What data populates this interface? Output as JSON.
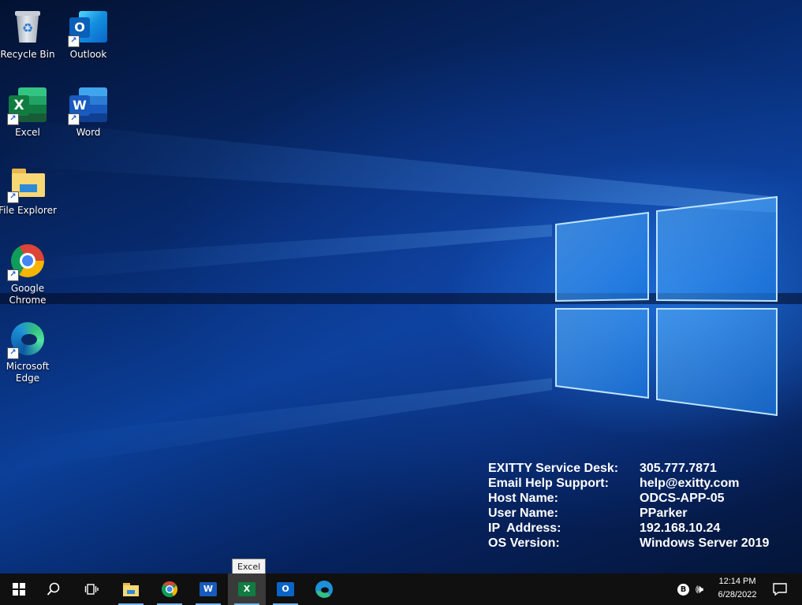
{
  "desktop": {
    "icons": [
      {
        "label": "Recycle Bin",
        "icon": "recycle-bin-icon"
      },
      {
        "label": "Outlook",
        "icon": "outlook-icon",
        "letter": "O"
      },
      {
        "label": "Excel",
        "icon": "excel-icon",
        "letter": "X"
      },
      {
        "label": "Word",
        "icon": "word-icon",
        "letter": "W"
      },
      {
        "label": "File Explorer",
        "icon": "file-explorer-icon"
      },
      {
        "label": "Google Chrome",
        "icon": "chrome-icon"
      },
      {
        "label": "Microsoft Edge",
        "icon": "edge-icon"
      }
    ],
    "shortcut_glyph": "↗"
  },
  "info": {
    "rows": [
      {
        "label": "EXITTY Service Desk:",
        "value": "305.777.7871"
      },
      {
        "label": "Email Help Support:",
        "value": "help@exitty.com"
      },
      {
        "label": "Host Name:",
        "value": "ODCS-APP-05"
      },
      {
        "label": "User Name:",
        "value": "PParker"
      },
      {
        "label": "IP  Address:",
        "value": "192.168.10.24"
      },
      {
        "label": "OS Version:",
        "value": "Windows Server 2019"
      }
    ]
  },
  "tooltip": {
    "text": "Excel"
  },
  "taskbar": {
    "items": [
      "start-icon",
      "search-icon",
      "task-view-icon",
      "file-explorer-icon",
      "chrome-icon",
      "word-icon",
      "excel-icon",
      "outlook-icon",
      "edge-icon"
    ],
    "word_letter": "W",
    "excel_letter": "X",
    "outlook_letter": "O",
    "active": "Excel",
    "tray": {
      "bluetooth_letter": "B",
      "volume_glyph": "🕪"
    },
    "clock": {
      "time": "12:14 PM",
      "date": "6/28/2022"
    },
    "accent": "#76b9ed"
  },
  "colors": {
    "taskbar": "#101010",
    "desktop": "#0b3f99"
  }
}
